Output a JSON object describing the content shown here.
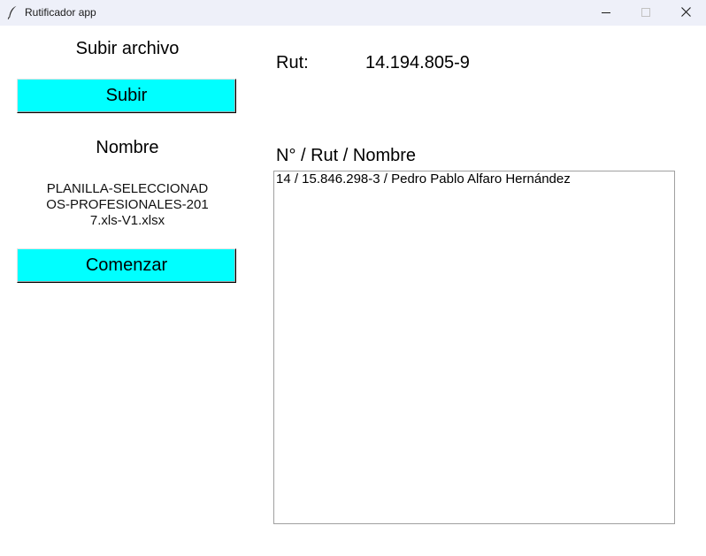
{
  "window": {
    "title": "Rutificador app",
    "icon": "feather-icon",
    "controls": [
      "minimize-icon",
      "maximize-icon",
      "close-icon"
    ]
  },
  "left_panel": {
    "upload_title": "Subir archivo",
    "upload_button": "Subir",
    "name_title": "Nombre",
    "file_name_lines": [
      "PLANILLA-SELECCIONAD",
      "OS-PROFESIONALES-201",
      "7.xls-V1.xlsx"
    ],
    "start_button": "Comenzar",
    "button_color": "#00ffff"
  },
  "right_panel": {
    "rut_label": "Rut:",
    "rut_value": "14.194.805-9",
    "list_header": "N° / Rut / Nombre",
    "list_items": [
      "14 / 15.846.298-3 / Pedro Pablo Alfaro Hernández"
    ]
  }
}
